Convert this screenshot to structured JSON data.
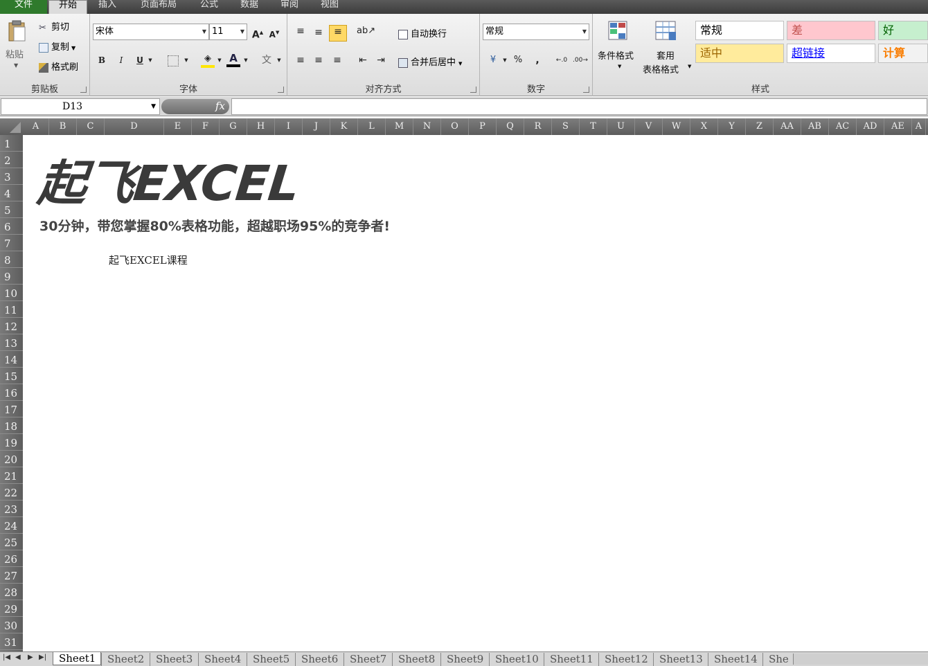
{
  "menu": {
    "file": "文件",
    "tabs": [
      "开始",
      "插入",
      "页面布局",
      "公式",
      "数据",
      "审阅",
      "视图"
    ]
  },
  "clipboard": {
    "paste": "粘贴",
    "cut": "剪切",
    "copy": "复制",
    "format_painter": "格式刷",
    "title": "剪贴板"
  },
  "font": {
    "name": "宋体",
    "size": "11",
    "bold": "B",
    "italic": "I",
    "underline": "U",
    "font_color_glyph": "A",
    "wen": "文",
    "grow": "A",
    "shrink": "A",
    "title": "字体"
  },
  "alignment": {
    "wrap": "自动换行",
    "merge": "合并后居中",
    "title": "对齐方式"
  },
  "number": {
    "format": "常规",
    "percent": "%",
    "comma": ",",
    "title": "数字"
  },
  "styles": {
    "conditional": "条件格式",
    "table_format_line1": "套用",
    "table_format_line2": "表格格式",
    "cells": [
      {
        "label": "常规",
        "bg": "#ffffff",
        "color": "#000000"
      },
      {
        "label": "差",
        "bg": "#ffc7ce",
        "color": "#c0504d"
      },
      {
        "label": "好",
        "bg": "#c6efce",
        "color": "#006100"
      },
      {
        "label": "适中",
        "bg": "#ffeb9c",
        "color": "#9c6500"
      },
      {
        "label": "超链接",
        "bg": "#ffffff",
        "color": "#0000ff"
      },
      {
        "label": "计算",
        "bg": "#f2f2f2",
        "color": "#fa7d00"
      }
    ],
    "title": "样式"
  },
  "formula_bar": {
    "name_box": "D13",
    "fx": "fx",
    "content": ""
  },
  "columns": [
    "A",
    "B",
    "C",
    "D",
    "E",
    "F",
    "G",
    "H",
    "I",
    "J",
    "K",
    "L",
    "M",
    "N",
    "O",
    "P",
    "Q",
    "R",
    "S",
    "T",
    "U",
    "V",
    "W",
    "X",
    "Y",
    "Z",
    "AA",
    "AB",
    "AC",
    "AD",
    "AE",
    "A"
  ],
  "rows": [
    "1",
    "2",
    "3",
    "4",
    "5",
    "6",
    "7",
    "8",
    "9",
    "10",
    "11",
    "12",
    "13",
    "14",
    "15",
    "16",
    "17",
    "18",
    "19",
    "20",
    "21",
    "22",
    "23",
    "24",
    "25",
    "26",
    "27",
    "28",
    "29",
    "30",
    "31"
  ],
  "sheet": {
    "logo": "起飞EXCEL",
    "slogan": "30分钟，带您掌握80%表格功能，超越职场95%的竞争者!",
    "cell_text": "起飞EXCEL课程"
  },
  "sheet_tabs": [
    "Sheet1",
    "Sheet2",
    "Sheet3",
    "Sheet4",
    "Sheet5",
    "Sheet6",
    "Sheet7",
    "Sheet8",
    "Sheet9",
    "Sheet10",
    "Sheet11",
    "Sheet12",
    "Sheet13",
    "Sheet14",
    "She"
  ],
  "accent": "#2f7a2c"
}
